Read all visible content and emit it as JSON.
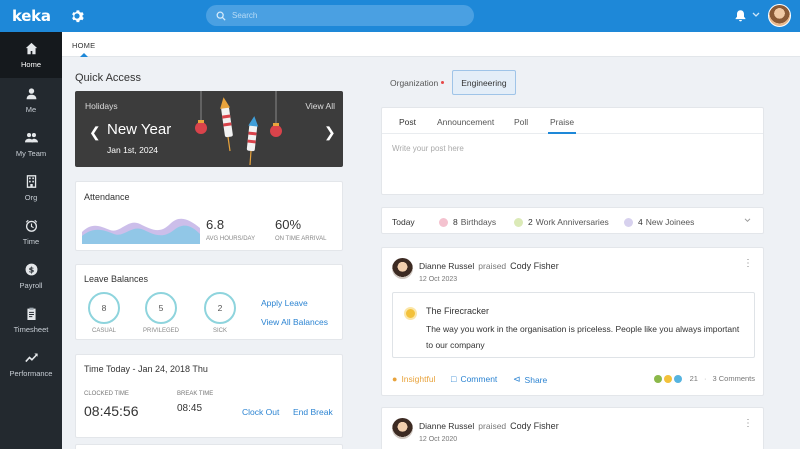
{
  "app": {
    "logo": "keka"
  },
  "sidebar": {
    "items": [
      {
        "label": "Home",
        "icon": "home-icon"
      },
      {
        "label": "Me",
        "icon": "user-icon"
      },
      {
        "label": "My Team",
        "icon": "team-icon"
      },
      {
        "label": "Org",
        "icon": "building-icon"
      },
      {
        "label": "Time",
        "icon": "clock-icon"
      },
      {
        "label": "Payroll",
        "icon": "dollar-icon"
      },
      {
        "label": "Timesheet",
        "icon": "clipboard-icon"
      },
      {
        "label": "Performance",
        "icon": "chart-line-icon"
      }
    ]
  },
  "topbar": {
    "search_placeholder": "Search"
  },
  "subnav": {
    "home": "HOME"
  },
  "quick_access": {
    "title": "Quick Access",
    "holidays": {
      "label": "Holidays",
      "view_all": "View All",
      "name": "New Year",
      "date": "Jan 1st, 2024"
    },
    "attendance": {
      "title": "Attendance",
      "avg_hours": "6.8",
      "avg_hours_label": "AVG HOURS/DAY",
      "on_time": "60%",
      "on_time_label": "ON TIME ARRIVAL"
    },
    "leave": {
      "title": "Leave Balances",
      "types": [
        {
          "label": "CASUAL",
          "value": "8"
        },
        {
          "label": "PRIVILEGED",
          "value": "5"
        },
        {
          "label": "SICK",
          "value": "2"
        }
      ],
      "apply": "Apply Leave",
      "view_all": "View All Balances"
    },
    "time_today": {
      "title": "Time Today - Jan 24, 2018 Thu",
      "clocked_label": "CLOCKED TIME",
      "clocked_value": "08:45:56",
      "break_label": "BREAK TIME",
      "break_value": "08:45",
      "clock_out": "Clock Out",
      "end_break": "End Break"
    }
  },
  "org_tabs": {
    "organization": "Organization",
    "engineering": "Engineering"
  },
  "post": {
    "tabs": [
      "Post",
      "Announcement",
      "Poll",
      "Praise"
    ],
    "placeholder": "Write your post here"
  },
  "today": {
    "label": "Today",
    "birthdays_count": "8",
    "birthdays": "Birthdays",
    "anniv_count": "2",
    "anniv": "Work Anniversaries",
    "joinees_count": "4",
    "joinees": "New Joinees"
  },
  "feed": [
    {
      "author": "Dianne Russel",
      "verb": "praised",
      "target": "Cody Fisher",
      "date": "12 Oct 2023",
      "praise_title": "The Firecracker",
      "praise_body": "The way you work in the organisation is priceless. People like you always important to our company",
      "insightful": "Insightful",
      "comment": "Comment",
      "share": "Share",
      "reaction_count": "21",
      "comments": "3 Comments"
    },
    {
      "author": "Dianne Russel",
      "verb": "praised",
      "target": "Cody Fisher",
      "date": "12 Oct 2020"
    }
  ],
  "colors": {
    "primary": "#1e88d8",
    "sidebar": "#23292f",
    "link": "#2c84d2",
    "ring": "#8ed4dd"
  }
}
